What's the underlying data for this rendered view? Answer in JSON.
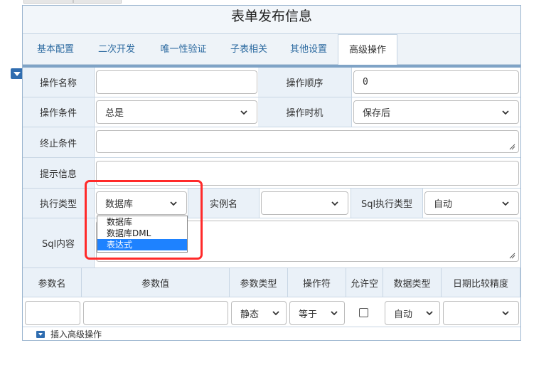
{
  "page": {
    "title": "表单发布信息"
  },
  "tabs": [
    {
      "label": "基本配置"
    },
    {
      "label": "二次开发"
    },
    {
      "label": "唯一性验证"
    },
    {
      "label": "子表相关"
    },
    {
      "label": "其他设置"
    },
    {
      "label": "高级操作"
    }
  ],
  "form": {
    "op_name_label": "操作名称",
    "op_name_value": "",
    "op_order_label": "操作顺序",
    "op_order_value": "0",
    "op_condition_label": "操作条件",
    "op_condition_value": "总是",
    "op_timing_label": "操作时机",
    "op_timing_value": "保存后",
    "stop_condition_label": "终止条件",
    "hint_label": "提示信息",
    "exec_type_label": "执行类型",
    "exec_type_value": "数据库",
    "instance_label": "实例名",
    "instance_value": "",
    "sql_exec_type_label": "Sql执行类型",
    "sql_exec_type_value": "自动",
    "sql_content_label": "Sql内容"
  },
  "dropdown": {
    "options": [
      "数据库",
      "数据库DML",
      "表达式"
    ],
    "highlighted": "表达式"
  },
  "params": {
    "headers": [
      "参数名",
      "参数值",
      "参数类型",
      "操作符",
      "允许空",
      "数据类型",
      "日期比较精度"
    ],
    "row": {
      "name": "",
      "value": "",
      "type": "静态",
      "operator": "等于",
      "allow_null": false,
      "data_type": "自动",
      "date_precision": ""
    }
  },
  "footer": {
    "insert_label": "插入高级操作"
  },
  "colors": {
    "accent": "#2c6aa0",
    "label_bg": "#eaf1f8",
    "highlight": "#ff2a2a",
    "selected": "#1e82ff"
  }
}
